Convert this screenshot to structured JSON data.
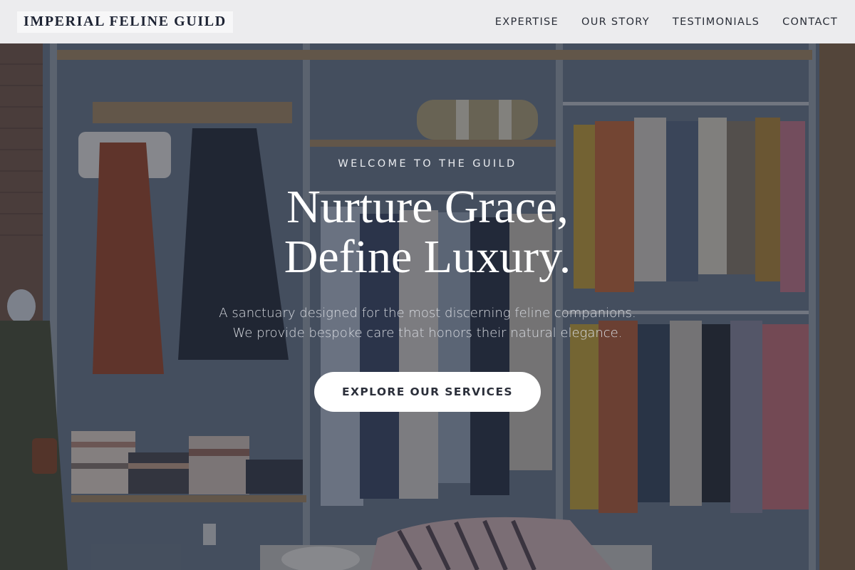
{
  "brand": {
    "name": "IMPERIAL FELINE GUILD"
  },
  "nav": {
    "items": [
      {
        "label": "EXPERTISE"
      },
      {
        "label": "OUR STORY"
      },
      {
        "label": "TESTIMONIALS"
      },
      {
        "label": "CONTACT"
      }
    ]
  },
  "hero": {
    "eyebrow": "WELCOME TO THE GUILD",
    "headline_line1": "Nurture Grace,",
    "headline_line2": "Define Luxury.",
    "subtext_line1": "A sanctuary designed for the most discerning feline companions.",
    "subtext_line2": "We provide bespoke care that honors their natural elegance.",
    "cta_label": "EXPLORE OUR SERVICES"
  },
  "colors": {
    "nav_background": "#ececee",
    "brand_text": "#1d2333",
    "overlay": "#181e2c",
    "cta_background": "#ffffff",
    "cta_text": "#2b2f3a"
  }
}
